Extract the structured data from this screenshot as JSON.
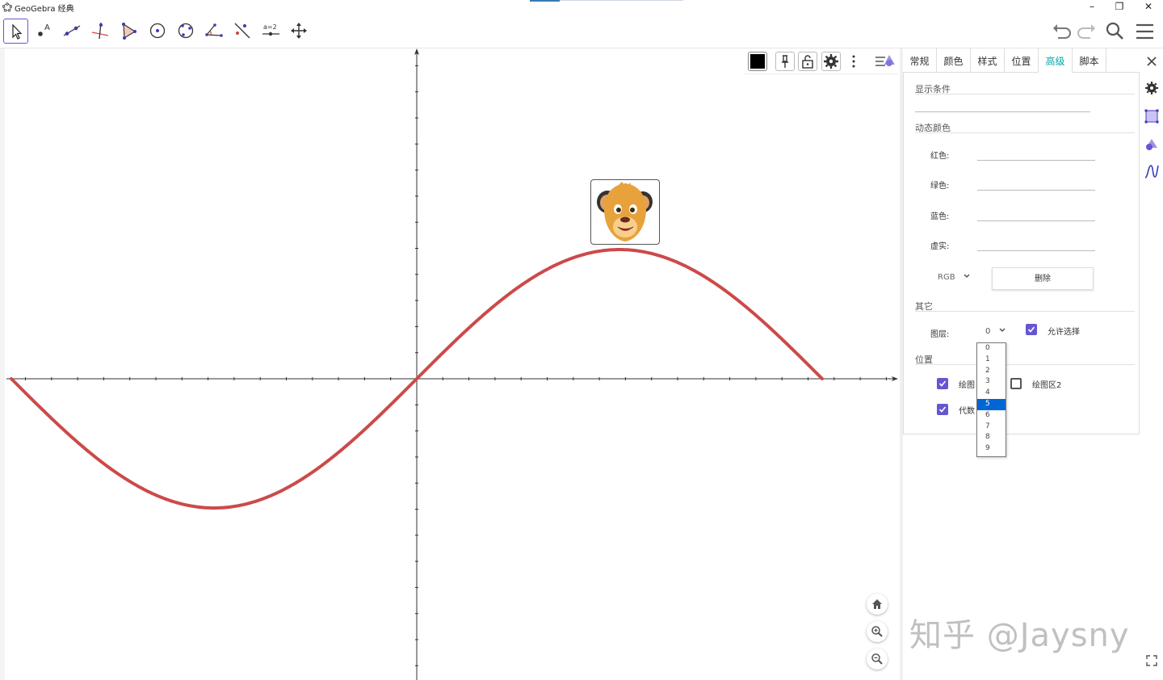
{
  "window": {
    "title": "GeoGebra 经典",
    "minimize": "–",
    "restore": "❐",
    "close": "✕"
  },
  "toolbar": {
    "tools": [
      "move-tool",
      "point-tool",
      "line-tool",
      "perpendicular-tool",
      "polygon-tool",
      "circle-tool",
      "circle-3-points-tool",
      "angle-tool",
      "reflect-tool",
      "slider-tool",
      "move-view-tool"
    ],
    "slider_text": "a=2"
  },
  "properties": {
    "tabs": [
      "常规",
      "颜色",
      "样式",
      "位置",
      "高级",
      "脚本"
    ],
    "active_tab": "高级",
    "condition_section": "显示条件",
    "dynamic_color_section": "动态颜色",
    "red_label": "红色:",
    "green_label": "绿色:",
    "blue_label": "蓝色:",
    "opacity_label": "虚实:",
    "color_model": "RGB",
    "delete_button": "删除",
    "other_section": "其它",
    "layer_label": "图层:",
    "layer_value": "0",
    "allow_select_label": "允许选择",
    "position_section": "位置",
    "graphics1_label": "绘图",
    "graphics2_label": "绘图区2",
    "algebra_label": "代数",
    "layer_options": [
      "0",
      "1",
      "2",
      "3",
      "4",
      "5",
      "6",
      "7",
      "8",
      "9"
    ],
    "highlighted_layer": "5"
  },
  "checkboxes": {
    "allow_select": true,
    "graphics1": true,
    "graphics2": false,
    "algebra": true
  },
  "graph": {
    "curve_color": "#cc4a4a",
    "function": "sine"
  },
  "watermark": "知乎 @Jaysny",
  "accent": "#6557d2"
}
